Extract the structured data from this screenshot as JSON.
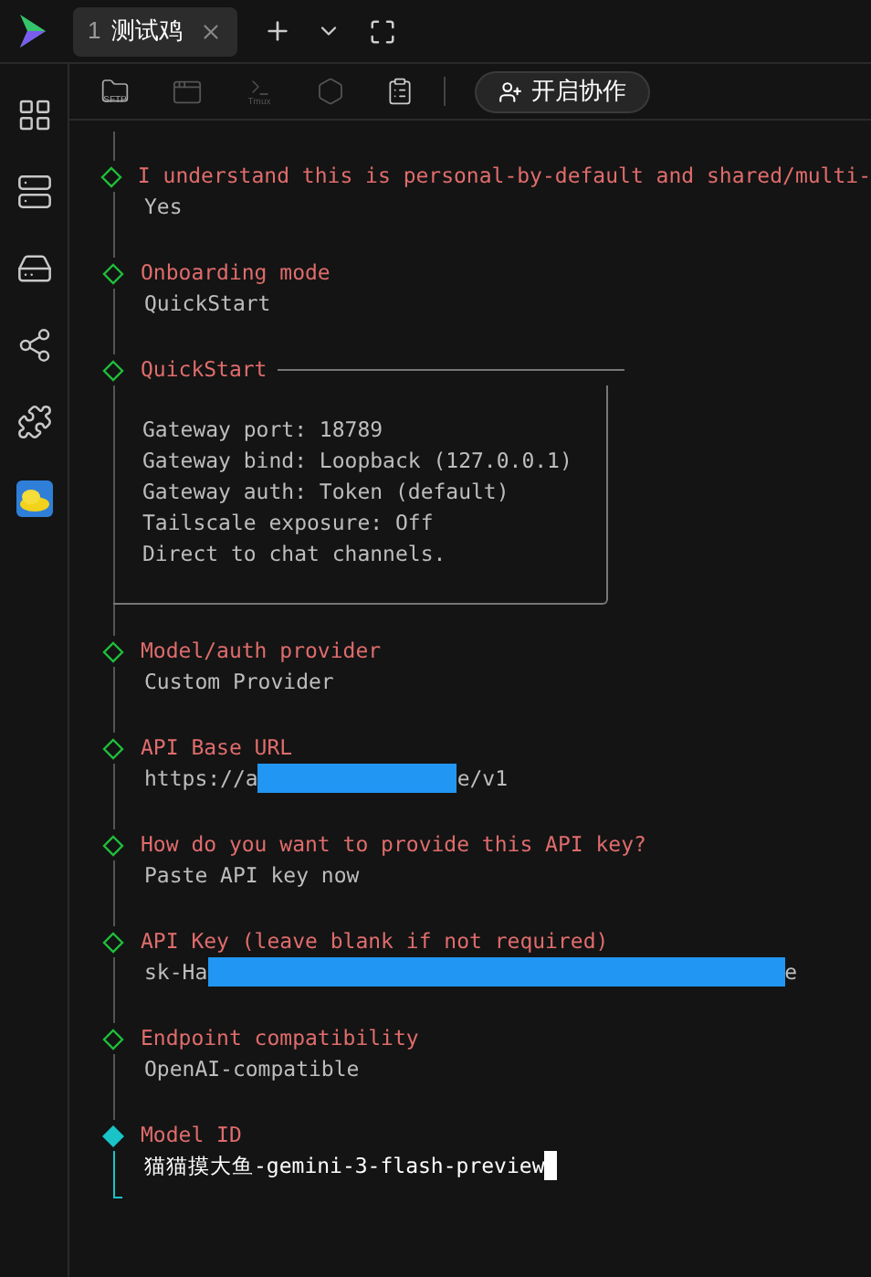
{
  "app_tab": {
    "number": "1",
    "title": "测试鸡",
    "selected": true
  },
  "toolbar": {
    "sftp_label": "SFTP",
    "tmux_label": "Tmux",
    "collab_button": "开启协作"
  },
  "sidebar": {
    "items": [
      {
        "kind": "grid"
      },
      {
        "kind": "server"
      },
      {
        "kind": "drive"
      },
      {
        "kind": "network"
      },
      {
        "kind": "plugin"
      },
      {
        "kind": "app"
      }
    ]
  },
  "steps": [
    {
      "active": false,
      "title": "I understand this is personal-by-default and shared/multi-",
      "value": "Yes"
    },
    {
      "active": false,
      "title": "Onboarding mode",
      "value": "QuickStart"
    },
    {
      "active": false,
      "kind": "note",
      "title": "QuickStart",
      "lines": [
        "Gateway port: 18789",
        "Gateway bind: Loopback (127.0.0.1)",
        "Gateway auth: Token (default)",
        "Tailscale exposure: Off",
        "Direct to chat channels."
      ]
    },
    {
      "active": false,
      "title": "Model/auth provider",
      "value": "Custom Provider"
    },
    {
      "active": false,
      "title": "API Base URL",
      "value": "https://a",
      "masked": true,
      "value_end": "e/v1"
    },
    {
      "active": false,
      "title": "How do you want to provide this API key?",
      "value": "Paste API key now"
    },
    {
      "active": false,
      "title": "API Key (leave blank if not required)",
      "value": "sk-Ha",
      "masked": true,
      "value_end": "e"
    },
    {
      "active": false,
      "title": "Endpoint compatibility",
      "value": "OpenAI-compatible"
    },
    {
      "active": true,
      "title": "Model ID",
      "value": "猫猫摸大鱼-gemini-3-flash-preview"
    }
  ]
}
